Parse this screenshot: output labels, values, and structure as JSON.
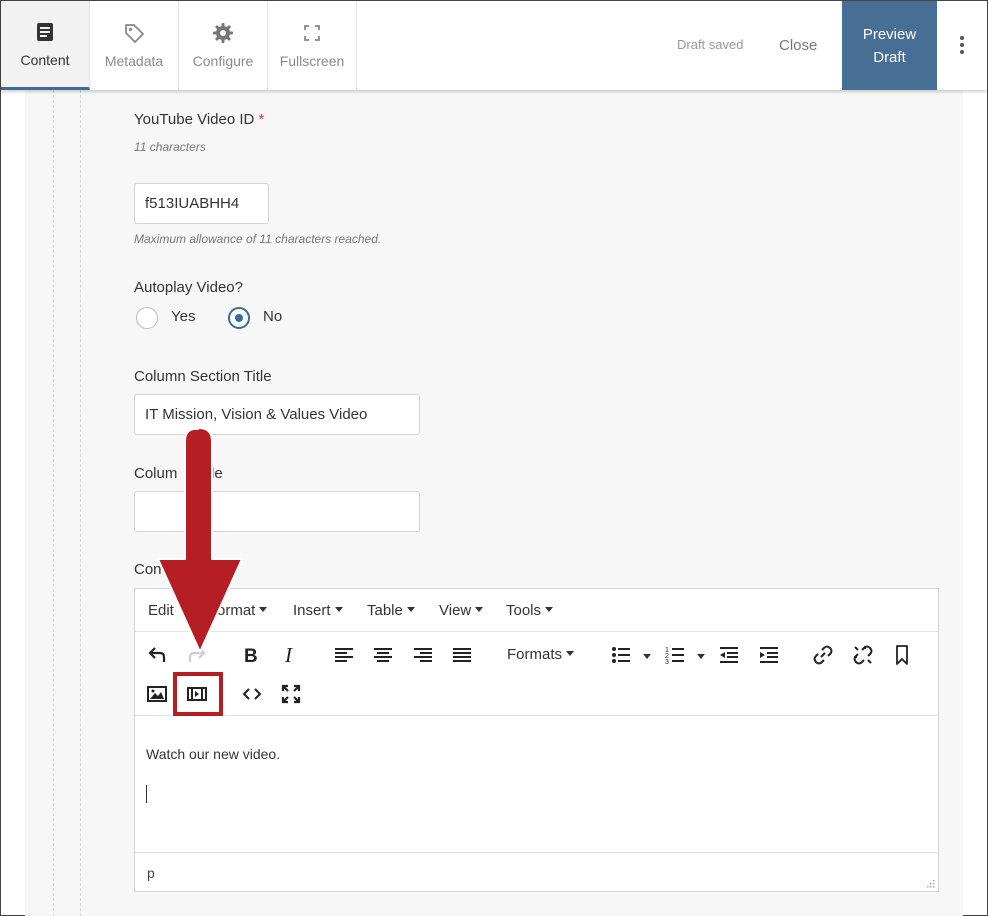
{
  "topbar": {
    "tabs": [
      {
        "label": "Content",
        "icon": "document-icon",
        "active": true
      },
      {
        "label": "Metadata",
        "icon": "tag-icon",
        "active": false
      },
      {
        "label": "Configure",
        "icon": "gear-icon",
        "active": false
      },
      {
        "label": "Fullscreen",
        "icon": "fullscreen-icon",
        "active": false
      }
    ],
    "draft_status": "Draft saved",
    "close_label": "Close",
    "preview_label_line1": "Preview",
    "preview_label_line2": "Draft",
    "accent_color": "#476f95"
  },
  "form": {
    "youtube": {
      "label": "YouTube Video ID",
      "required_mark": "*",
      "hint": "11 characters",
      "value": "f513IUABHH4",
      "help": "Maximum allowance of 11 characters reached."
    },
    "autoplay": {
      "label": "Autoplay Video?",
      "options": [
        "Yes",
        "No"
      ],
      "selected": "No"
    },
    "column_section_title": {
      "label": "Column Section Title",
      "value": "IT Mission, Vision & Values Video"
    },
    "column_title": {
      "label_left": "Colum",
      "label_right": "le",
      "value": ""
    },
    "content": {
      "label": "Con"
    }
  },
  "editor": {
    "menu": [
      "Edit",
      "ormat",
      "Insert",
      "Table",
      "View",
      "Tools"
    ],
    "formats_label": "Formats",
    "body_text": "Watch our new video.",
    "status_path": "p",
    "toolbar_icons": [
      "undo-icon",
      "redo-icon",
      "bold-icon",
      "italic-icon",
      "align-left-icon",
      "align-center-icon",
      "align-right-icon",
      "align-justify-icon",
      "bullet-list-icon",
      "numbered-list-icon",
      "outdent-icon",
      "indent-icon",
      "link-icon",
      "unlink-icon",
      "bookmark-icon",
      "image-icon",
      "media-icon",
      "code-icon",
      "fullscreen-icon"
    ]
  },
  "annotation": {
    "color": "#b51e22",
    "target": "media-icon"
  }
}
